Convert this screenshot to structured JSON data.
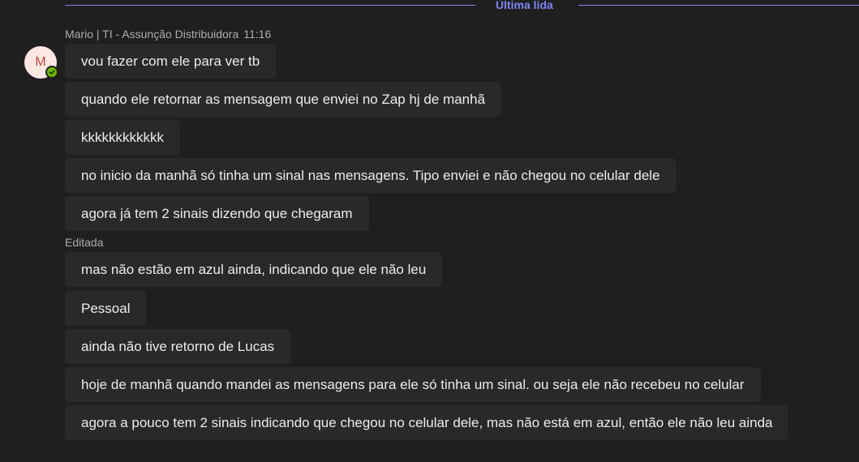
{
  "divider": {
    "label": "Última lida"
  },
  "sender": {
    "initial": "M",
    "name": "Mario | TI - Assunção Distribuidora",
    "time": "11:16",
    "presence": "available"
  },
  "edited_label": "Editada",
  "messages": [
    "vou fazer com ele para ver tb",
    "quando ele retornar as mensagem que enviei no Zap hj de manhã",
    "kkkkkkkkkkkk",
    "no inicio da manhã só tinha um sinal nas mensagens. Tipo enviei e não chegou no celular dele",
    "agora já tem 2 sinais dizendo que chegaram",
    "mas não estão em azul ainda, indicando que ele não leu",
    "Pessoal",
    "ainda não tive retorno de Lucas",
    "hoje de manhã quando mandei as mensagens para ele só tinha um sinal. ou seja ele não recebeu no celular",
    "agora a pouco tem 2 sinais indicando que chegou no celular dele, mas não está em azul, então ele não leu ainda"
  ],
  "colors": {
    "background": "#1f1f1f",
    "bubble": "#292929",
    "accent": "#7f85f5",
    "presence": "#6bb700"
  }
}
